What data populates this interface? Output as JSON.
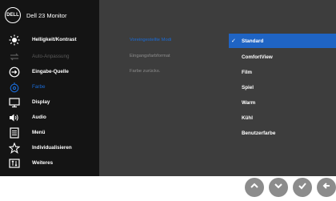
{
  "osd": {
    "title": "Dell 23 Monitor",
    "logo_text": "DELL",
    "menu": [
      {
        "label": "Helligkeit/Kontrast",
        "icon": "brightness-icon",
        "state": "normal"
      },
      {
        "label": "Auto-Anpassung",
        "icon": "auto-adjust-icon",
        "state": "disabled"
      },
      {
        "label": "Eingabe-Quelle",
        "icon": "input-source-icon",
        "state": "normal"
      },
      {
        "label": "Farbe",
        "icon": "color-icon",
        "state": "active"
      },
      {
        "label": "Display",
        "icon": "display-icon",
        "state": "normal"
      },
      {
        "label": "Audio",
        "icon": "audio-icon",
        "state": "normal"
      },
      {
        "label": "Menü",
        "icon": "menu-icon",
        "state": "normal"
      },
      {
        "label": "Individualisieren",
        "icon": "star-icon",
        "state": "normal"
      },
      {
        "label": "Weiteres",
        "icon": "others-icon",
        "state": "normal"
      }
    ],
    "submenu": [
      {
        "label": "Voreingestellte Modi",
        "selected": true
      },
      {
        "label": "Eingangsfarbformat",
        "selected": false
      },
      {
        "label": "Farbe zurücks.",
        "selected": false
      }
    ],
    "options": [
      {
        "label": "Standard",
        "checked": true
      },
      {
        "label": "ComfortView",
        "checked": false
      },
      {
        "label": "Film",
        "checked": false
      },
      {
        "label": "Spiel",
        "checked": false
      },
      {
        "label": "Warm",
        "checked": false
      },
      {
        "label": "Kühl",
        "checked": false
      },
      {
        "label": "Benutzerfarbe",
        "checked": false
      }
    ],
    "check_mark": "✓"
  },
  "buttons": [
    {
      "name": "up-button",
      "icon": "chevron-up-icon"
    },
    {
      "name": "down-button",
      "icon": "chevron-down-icon"
    },
    {
      "name": "ok-button",
      "icon": "check-icon"
    },
    {
      "name": "back-button",
      "icon": "back-arrow-icon"
    }
  ],
  "colors": {
    "accent": "#1f64c4",
    "sidebar": "#141414",
    "panel": "#3d3d3d",
    "button": "#8c8c8c"
  }
}
